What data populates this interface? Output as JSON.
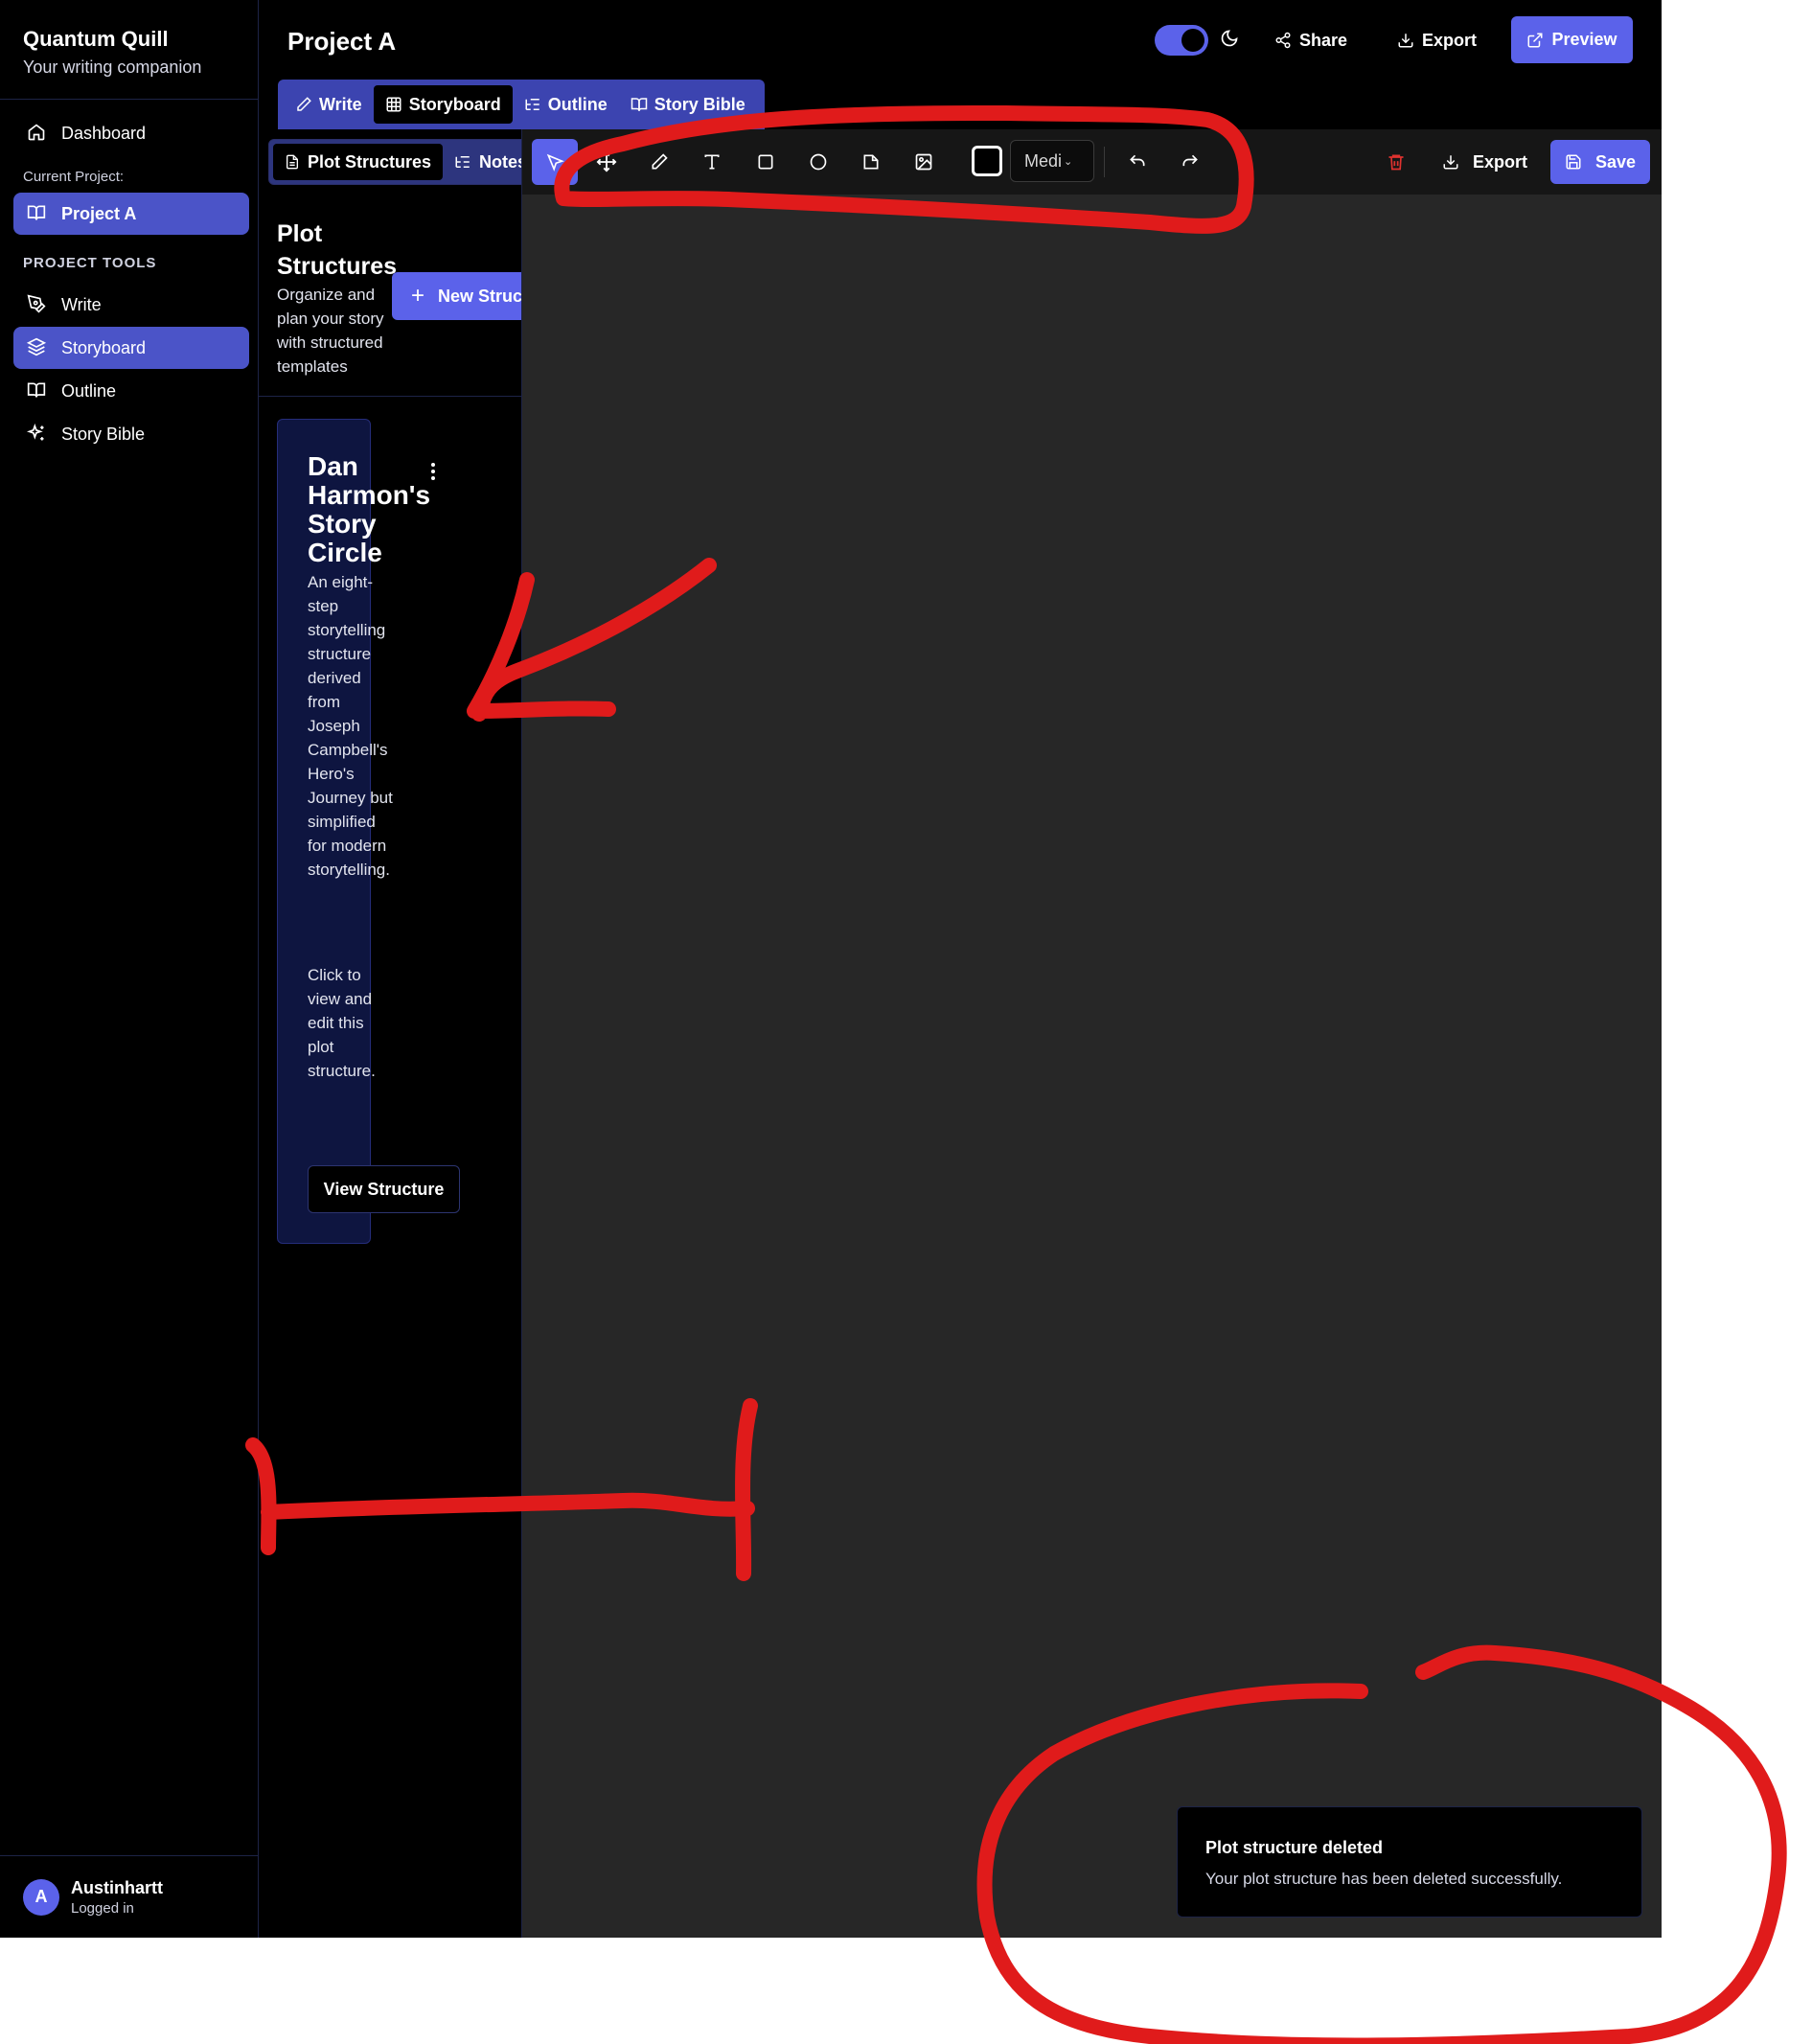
{
  "app": {
    "title": "Quantum Quill",
    "subtitle": "Your writing companion"
  },
  "sidebar": {
    "dashboard_label": "Dashboard",
    "current_project_label": "Current Project:",
    "current_project": "Project A",
    "tools_heading": "PROJECT TOOLS",
    "items": [
      {
        "label": "Write",
        "icon": "pen-tool-icon"
      },
      {
        "label": "Storyboard",
        "icon": "layers-icon",
        "active": true
      },
      {
        "label": "Outline",
        "icon": "book-open-icon"
      },
      {
        "label": "Story Bible",
        "icon": "sparkles-icon"
      }
    ],
    "user": {
      "initial": "A",
      "name": "Austinhartt",
      "status": "Logged in"
    }
  },
  "header": {
    "project_title": "Project A",
    "dark_mode": true,
    "share_label": "Share",
    "export_label": "Export",
    "preview_label": "Preview"
  },
  "main_tabs": [
    "Write",
    "Storyboard",
    "Outline",
    "Story Bible"
  ],
  "main_tab_active": "Storyboard",
  "left_panel": {
    "sub_tabs": [
      "Plot Structures",
      "Notes"
    ],
    "sub_tab_active": "Plot Structures",
    "title": "Plot Structures",
    "description": "Organize and plan your story with structured templates",
    "new_button_label": "New Struc",
    "card": {
      "title": "Dan Harmon's Story Circle",
      "description": "An eight-step storytelling structure derived from Joseph Campbell's Hero's Journey but simplified for modern storytelling.",
      "hint": "Click to view and edit this plot structure.",
      "button_label": "View Structure"
    }
  },
  "toolbar": {
    "tools": [
      "select-icon",
      "move-icon",
      "pencil-icon",
      "text-icon",
      "rectangle-icon",
      "circle-icon",
      "sticky-note-icon",
      "image-icon"
    ],
    "active_tool": "select-icon",
    "stroke_color": "#000000",
    "size_value": "Medi",
    "export_label": "Export",
    "save_label": "Save"
  },
  "toast": {
    "title": "Plot structure deleted",
    "message": "Your plot structure has been deleted successfully."
  },
  "colors": {
    "accent": "#5b62ea",
    "sidebar_active": "#4b54c8",
    "annotation": "#e01b1b",
    "canvas": "#272727"
  }
}
